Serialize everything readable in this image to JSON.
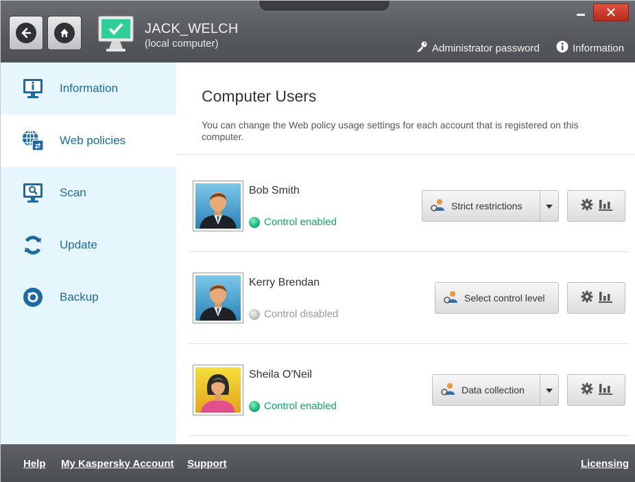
{
  "header": {
    "computer_name": "JACK_WELCH",
    "computer_subtitle": "(local computer)",
    "admin_password_label": "Administrator password",
    "information_label": "Information"
  },
  "sidebar": {
    "items": [
      {
        "label": "Information",
        "icon": "monitor-info-icon"
      },
      {
        "label": "Web policies",
        "icon": "globe-policy-icon"
      },
      {
        "label": "Scan",
        "icon": "monitor-scan-icon"
      },
      {
        "label": "Update",
        "icon": "refresh-icon"
      },
      {
        "label": "Backup",
        "icon": "backup-icon"
      }
    ],
    "active_index": 1
  },
  "main": {
    "title": "Computer Users",
    "description": "You can change the Web policy usage settings for each account that is registered on this computer.",
    "users": [
      {
        "name": "Bob Smith",
        "status": "Control enabled",
        "status_on": true,
        "policy": "Strict restrictions",
        "has_dropdown": true
      },
      {
        "name": "Kerry Brendan",
        "status": "Control disabled",
        "status_on": false,
        "policy": "Select control level",
        "has_dropdown": false
      },
      {
        "name": "Sheila O'Neil",
        "status": "Control enabled",
        "status_on": true,
        "policy": "Data collection",
        "has_dropdown": true
      }
    ]
  },
  "footer": {
    "help": "Help",
    "account": "My Kaspersky Account",
    "support": "Support",
    "licensing": "Licensing"
  },
  "colors": {
    "sidebar_bg": "#e6f6fd",
    "sidebar_text": "#1e6aa0",
    "status_on": "#0aa66b",
    "status_off": "#9a9a9a",
    "header_bg": "#55585d",
    "close_red": "#c8372a"
  }
}
